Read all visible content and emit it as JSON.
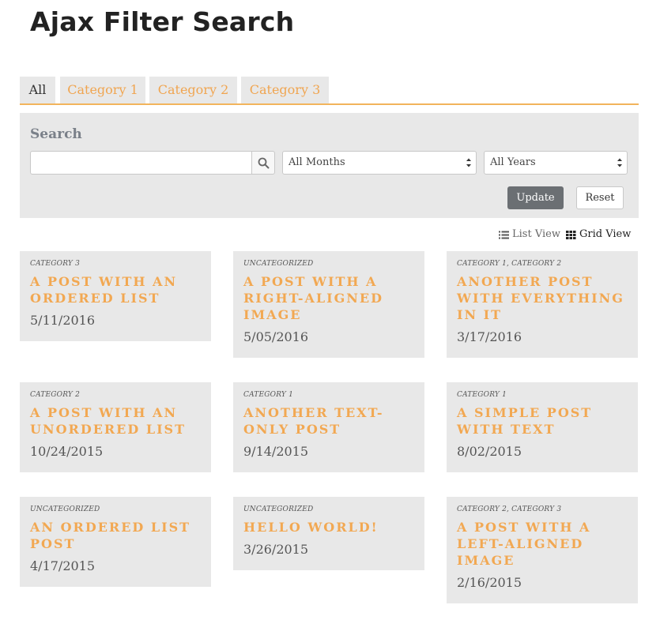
{
  "page": {
    "title": "Ajax Filter Search"
  },
  "tabs": [
    {
      "label": "All",
      "active": true
    },
    {
      "label": "Category 1",
      "active": false
    },
    {
      "label": "Category 2",
      "active": false
    },
    {
      "label": "Category 3",
      "active": false
    }
  ],
  "search": {
    "label": "Search",
    "value": "",
    "placeholder": "",
    "button_icon": "search-icon",
    "month_select": "All Months",
    "year_select": "All Years",
    "update_label": "Update",
    "reset_label": "Reset"
  },
  "view": {
    "list_label": "List View",
    "list_icon": "list-icon",
    "grid_label": "Grid View",
    "grid_icon": "grid-icon",
    "selected": "Grid View"
  },
  "colors": {
    "accent": "#f2a852",
    "panel_bg": "#e8e8e8",
    "update_button": "#6b6f73"
  },
  "posts": [
    {
      "category": "Category 3",
      "title": "A Post With An Ordered List",
      "date": "5/11/2016"
    },
    {
      "category": "Uncategorized",
      "title": "A Post With A Right-Aligned Image",
      "date": "5/05/2016"
    },
    {
      "category": "Category 1, Category 2",
      "title": "Another Post With Everything In It",
      "date": "3/17/2016"
    },
    {
      "category": "Category 2",
      "title": "A Post With An Unordered List",
      "date": "10/24/2015"
    },
    {
      "category": "Category 1",
      "title": "Another Text-Only Post",
      "date": "9/14/2015"
    },
    {
      "category": "Category 1",
      "title": "A Simple Post With Text",
      "date": "8/02/2015"
    },
    {
      "category": "Uncategorized",
      "title": "An Ordered List Post",
      "date": "4/17/2015"
    },
    {
      "category": "Uncategorized",
      "title": "Hello World!",
      "date": "3/26/2015"
    },
    {
      "category": "Category 2, Category 3",
      "title": "A Post With A Left-Aligned Image",
      "date": "2/16/2015"
    }
  ]
}
